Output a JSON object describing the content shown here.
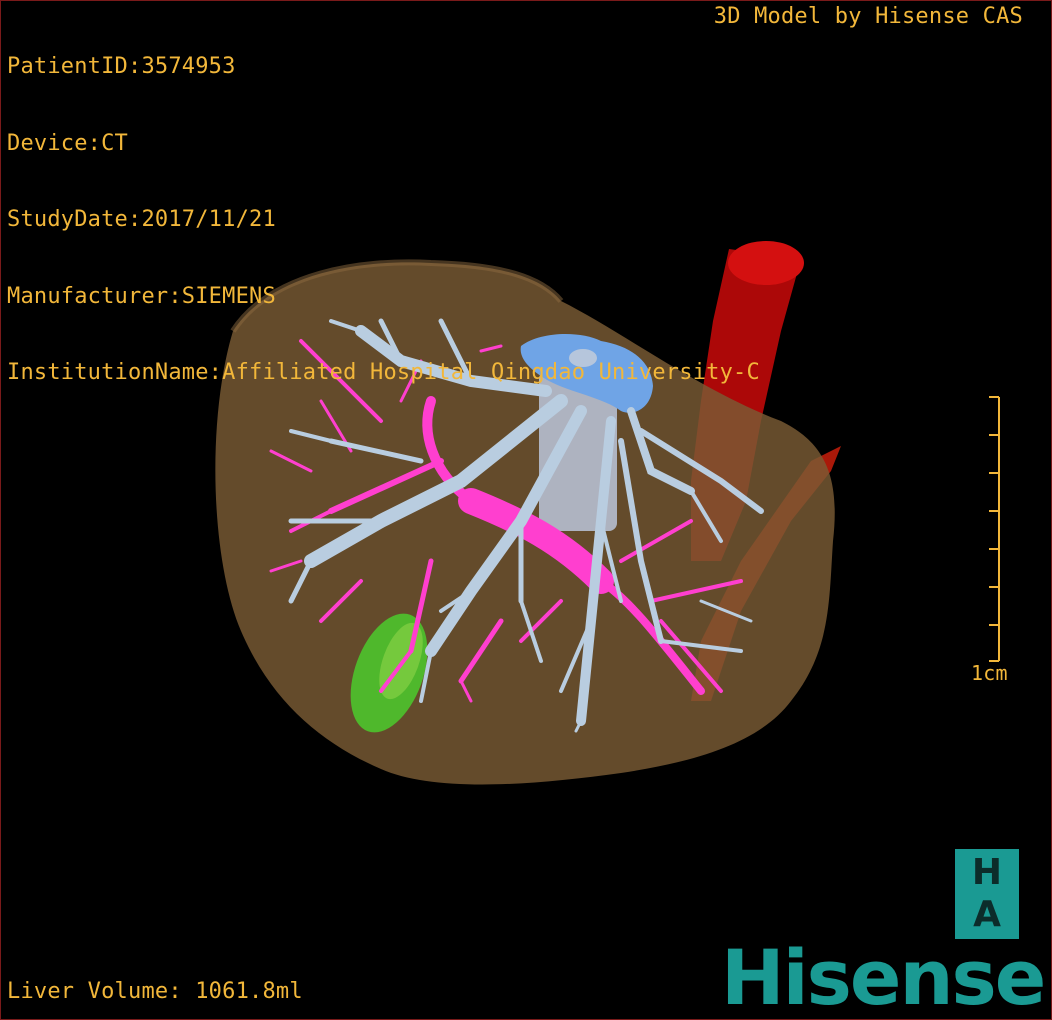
{
  "header": {
    "patient_id": "PatientID:3574953",
    "device": "Device:CT",
    "study_date": "StudyDate:2017/11/21",
    "manufacturer": "Manufacturer:SIEMENS",
    "institution": "InstitutionName:Affiliated Hospital Qingdao University-C"
  },
  "brand_caption": "3D Model by Hisense CAS",
  "scale_bar": {
    "label": "1cm",
    "tick_count": 7
  },
  "footer": {
    "liver_volume": "Liver Volume: 1061.8ml"
  },
  "logo": {
    "ha_top": "H",
    "ha_bottom": "A",
    "wordmark": "Hisense"
  },
  "colors": {
    "overlay_text": "#f2b73a",
    "liver": "#7a5c35",
    "hepatic_veins": "#b9cde0",
    "portal_vein": "#ff3fcf",
    "ivc": "#6fa4e6",
    "aorta": "#c80a0a",
    "gallbladder": "#4fb82c",
    "brand_teal": "#1a9a93"
  }
}
